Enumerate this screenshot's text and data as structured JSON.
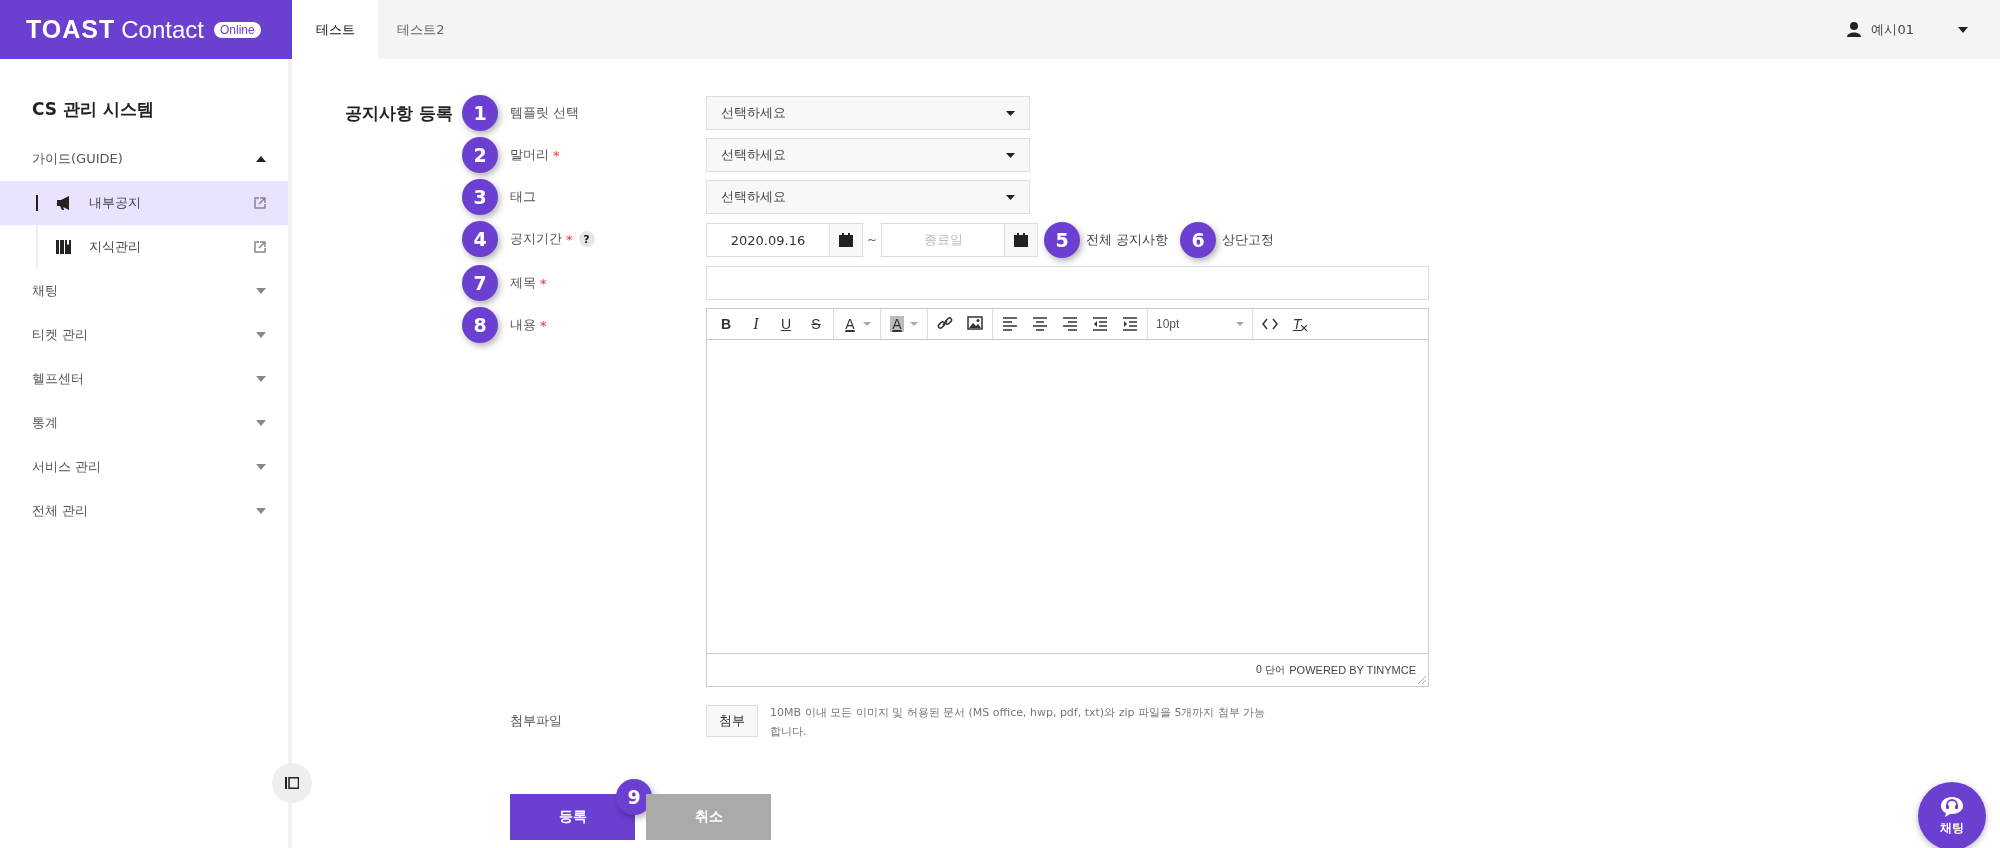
{
  "header": {
    "logo": {
      "wordmark": "TOAST",
      "product": "Contact",
      "badge": "Online"
    },
    "tabs": [
      {
        "label": "테스트",
        "selected": true
      },
      {
        "label": "테스트2",
        "selected": false
      }
    ],
    "user": {
      "name": "예시01"
    }
  },
  "sidebar": {
    "title": "CS 관리 시스템",
    "menu": [
      {
        "label": "가이드(GUIDE)",
        "expanded": true,
        "children": [
          {
            "label": "내부공지",
            "selected": true
          },
          {
            "label": "지식관리",
            "selected": false
          }
        ]
      },
      {
        "label": "채팅",
        "expanded": false
      },
      {
        "label": "티켓 관리",
        "expanded": false
      },
      {
        "label": "헬프센터",
        "expanded": false
      },
      {
        "label": "통계",
        "expanded": false
      },
      {
        "label": "서비스 관리",
        "expanded": false
      },
      {
        "label": "전체 관리",
        "expanded": false
      }
    ]
  },
  "form": {
    "title": "공지사항 등록",
    "rows": [
      {
        "step": "1",
        "label": "템플릿 선택",
        "kind": "select",
        "placeholder": "선택하세요"
      },
      {
        "step": "2",
        "label": "말머리",
        "required_mark": "*",
        "kind": "select",
        "placeholder": "선택하세요"
      },
      {
        "step": "3",
        "label": "태그",
        "kind": "select",
        "placeholder": "선택하세요"
      },
      {
        "step": "4",
        "label": "공지기간",
        "required_mark": "*",
        "help": "?",
        "kind": "date_range",
        "start": "2020.09.16",
        "separator": "~",
        "end_placeholder": "종료일",
        "options": [
          {
            "step": "5",
            "label": "전체 공지사항"
          },
          {
            "step": "6",
            "label": "상단고정"
          }
        ]
      },
      {
        "step": "7",
        "label": "제목",
        "required_mark": "*",
        "kind": "text"
      },
      {
        "step": "8",
        "label": "내용",
        "required_mark": "*",
        "kind": "editor",
        "toolbar": [
          [
            {
              "kind": "bold",
              "glyph": "B"
            },
            {
              "kind": "italic",
              "glyph": "I"
            },
            {
              "kind": "underline",
              "glyph": "U"
            },
            {
              "kind": "strike",
              "glyph": "S"
            }
          ],
          [
            {
              "kind": "forecolor",
              "glyph": "A"
            }
          ],
          [
            {
              "kind": "backcolor",
              "glyph": "A"
            }
          ],
          [
            {
              "kind": "link"
            },
            {
              "kind": "image"
            }
          ],
          [
            {
              "kind": "align_left"
            },
            {
              "kind": "align_center"
            },
            {
              "kind": "align_right"
            },
            {
              "kind": "outdent"
            },
            {
              "kind": "indent"
            }
          ],
          [
            {
              "kind": "fontsize",
              "value": "10pt"
            }
          ],
          [
            {
              "kind": "code"
            },
            {
              "kind": "clear_format",
              "glyph": "T"
            }
          ]
        ],
        "word_count": "0 단어",
        "powered_by": "POWERED BY TINYMCE"
      },
      {
        "label": "첨부파일",
        "kind": "file",
        "button": "첨부",
        "note": "10MB 이내 모든 이미지 및 허용된 문서 (MS office, hwp, pdf, txt)와 zip 파일을 5개까지 첨부 가능합니다."
      }
    ],
    "buttons": [
      {
        "label": "등록",
        "kind": "primary",
        "step": "9"
      },
      {
        "label": "취소",
        "kind": "secondary"
      }
    ]
  },
  "chat_button": {
    "label": "채팅"
  }
}
